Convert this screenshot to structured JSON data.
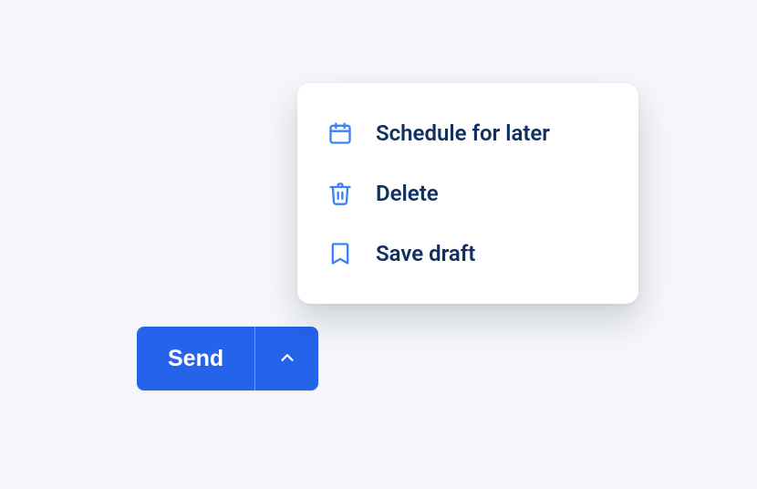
{
  "button": {
    "send_label": "Send"
  },
  "menu": {
    "items": [
      {
        "label": "Schedule for later"
      },
      {
        "label": "Delete"
      },
      {
        "label": "Save draft"
      }
    ]
  },
  "colors": {
    "primary": "#2563eb",
    "icon": "#3b82f6",
    "text": "#0f3061",
    "background": "#f5f7fa",
    "panel": "#ffffff"
  }
}
